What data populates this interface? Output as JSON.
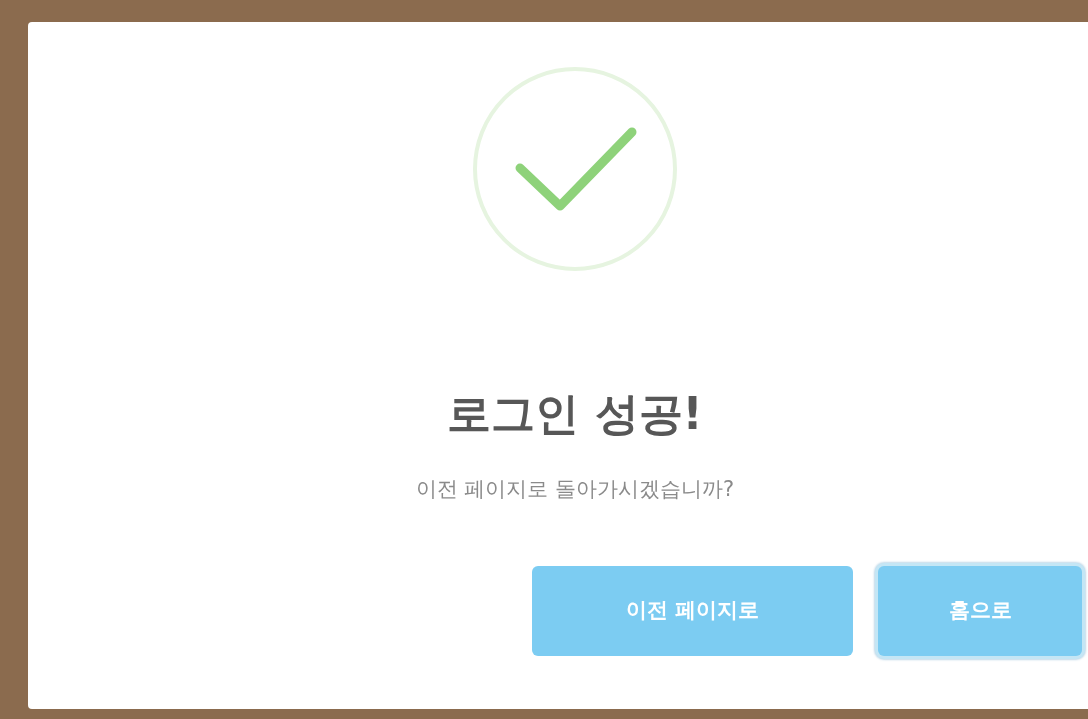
{
  "dialog": {
    "icon": {
      "kind": "success"
    },
    "title": "로그인 성공!",
    "message": "이전 페이지로 돌아가시겠습니까?",
    "buttons": [
      {
        "label": "이전 페이지로",
        "focused": false
      },
      {
        "label": "홈으로",
        "focused": true
      }
    ]
  }
}
